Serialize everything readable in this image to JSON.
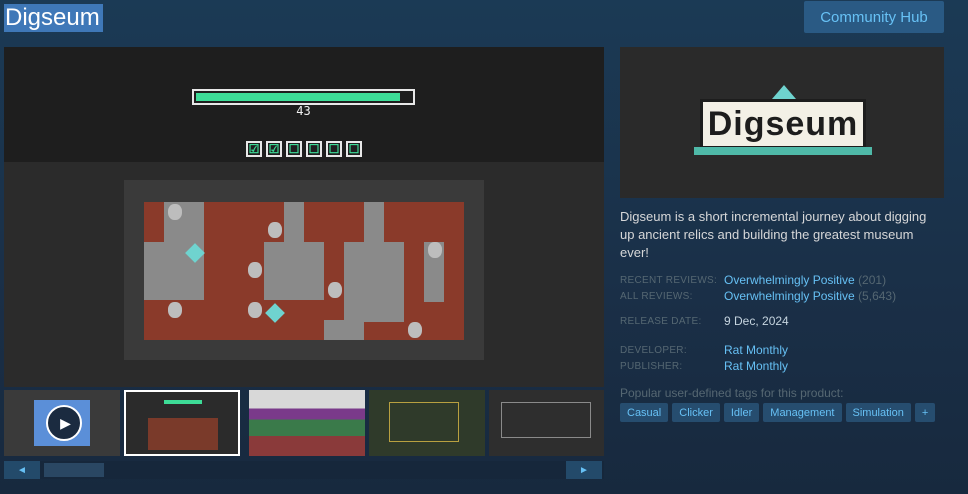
{
  "header": {
    "title": "Digseum",
    "community_hub_label": "Community Hub"
  },
  "media": {
    "progress": {
      "fraction": 0.95,
      "value": "43"
    },
    "checkboxes": [
      "☑",
      "☑",
      "☐",
      "☐",
      "☐",
      "☐"
    ],
    "thumbnails": [
      "video",
      "screenshot-active",
      "screenshot",
      "screenshot",
      "screenshot"
    ],
    "scroll_left_icon": "◄",
    "scroll_right_icon": "►",
    "play_icon": "▶"
  },
  "capsule": {
    "logo_text": "Digseum"
  },
  "description": "Digseum is a short incremental journey about digging up ancient relics and building the greatest museum ever!",
  "reviews": {
    "recent": {
      "label": "RECENT REVIEWS:",
      "summary": "Overwhelmingly Positive",
      "count": "(201)"
    },
    "all": {
      "label": "ALL REVIEWS:",
      "summary": "Overwhelmingly Positive",
      "count": "(5,643)"
    }
  },
  "release": {
    "label": "RELEASE DATE:",
    "date": "9 Dec, 2024"
  },
  "developer": {
    "label": "DEVELOPER:",
    "name": "Rat Monthly"
  },
  "publisher": {
    "label": "PUBLISHER:",
    "name": "Rat Monthly"
  },
  "tags": {
    "heading": "Popular user-defined tags for this product:",
    "items": [
      "Casual",
      "Clicker",
      "Idler",
      "Management",
      "Simulation",
      "+"
    ]
  },
  "colors": {
    "accent": "#66c0f4",
    "button_bg": "#2a5a84",
    "progress": "#3ddc97"
  }
}
